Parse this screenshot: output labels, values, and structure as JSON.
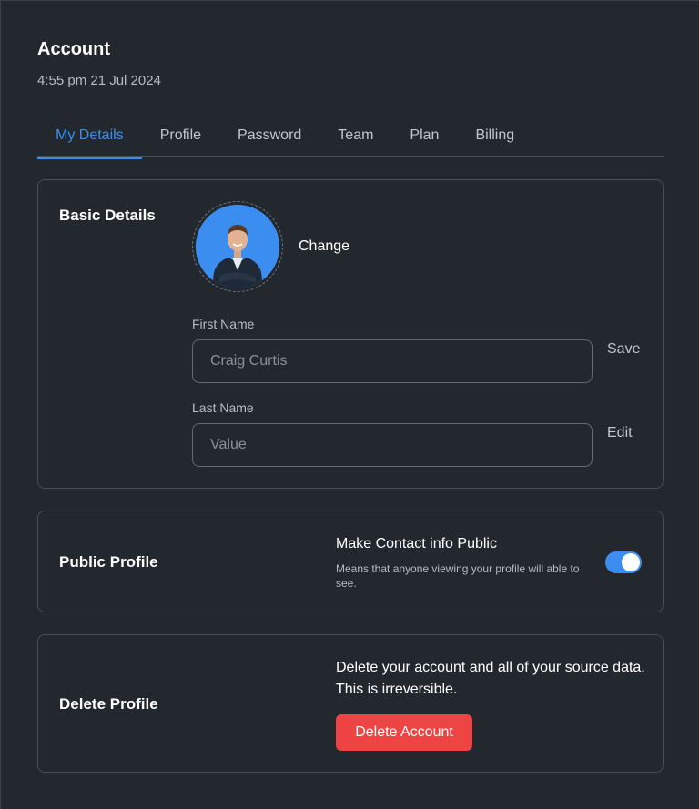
{
  "header": {
    "title": "Account",
    "timestamp": "4:55 pm 21 Jul 2024"
  },
  "tabs": [
    {
      "label": "My Details",
      "active": true
    },
    {
      "label": "Profile",
      "active": false
    },
    {
      "label": "Password",
      "active": false
    },
    {
      "label": "Team",
      "active": false
    },
    {
      "label": "Plan",
      "active": false
    },
    {
      "label": "Billing",
      "active": false
    }
  ],
  "basic_details": {
    "title": "Basic Details",
    "avatar_icon": "user-photo",
    "change_label": "Change",
    "first_name": {
      "label": "First Name",
      "value": "",
      "placeholder": "Craig Curtis"
    },
    "last_name": {
      "label": "Last Name",
      "value": "",
      "placeholder": "Value"
    },
    "save_label": "Save",
    "edit_label": "Edit"
  },
  "public_profile": {
    "title": "Public Profile",
    "toggle_title": "Make Contact info Public",
    "toggle_description": "Means that anyone viewing your profile will able to see.",
    "toggle_on": true
  },
  "delete_profile": {
    "title": "Delete Profile",
    "description": "Delete your account and all of your source data. This is irreversible.",
    "button_label": "Delete Account"
  },
  "colors": {
    "background": "#23282e",
    "accent": "#3b8ef0",
    "danger": "#ef4444"
  }
}
